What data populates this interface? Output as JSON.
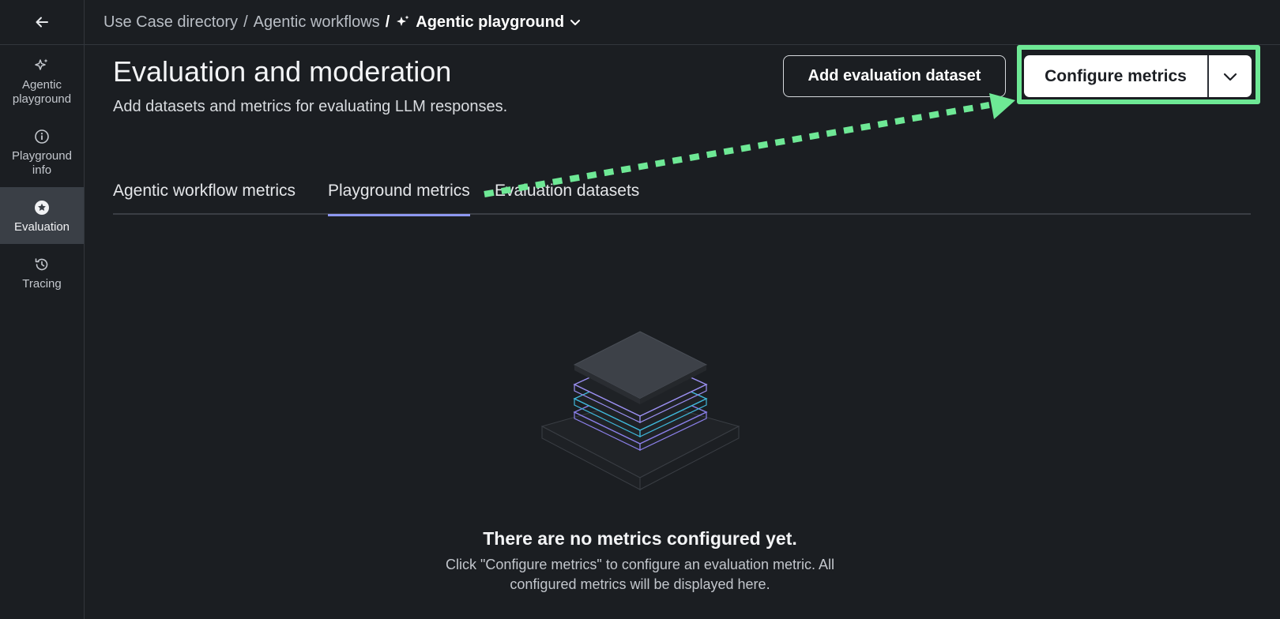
{
  "sidebar": {
    "back_icon": "arrow-left-icon",
    "items": [
      {
        "label": "Agentic playground",
        "icon": "sparkles-icon",
        "active": false
      },
      {
        "label": "Playground info",
        "icon": "info-icon",
        "active": false
      },
      {
        "label": "Evaluation",
        "icon": "star-badge-icon",
        "active": true
      },
      {
        "label": "Tracing",
        "icon": "history-icon",
        "active": false
      }
    ]
  },
  "breadcrumb": {
    "items": [
      "Use Case directory",
      "Agentic workflows"
    ],
    "separator": "/",
    "current": "Agentic playground",
    "current_icon": "sparkles-icon"
  },
  "header": {
    "title": "Evaluation and moderation",
    "subtitle": "Add datasets and metrics for evaluating LLM responses."
  },
  "actions": {
    "add_dataset_label": "Add evaluation dataset",
    "configure_metrics_label": "Configure metrics"
  },
  "tabs": [
    {
      "label": "Agentic workflow metrics",
      "active": false
    },
    {
      "label": "Playground metrics",
      "active": true
    },
    {
      "label": "Evaluation datasets",
      "active": false
    }
  ],
  "empty_state": {
    "title": "There are no metrics configured yet.",
    "description": "Click \"Configure metrics\" to configure an evaluation metric. All configured metrics will be displayed here."
  },
  "colors": {
    "background": "#1b1e22",
    "annotation": "#6ee895",
    "tab_active": "#8d97f0"
  }
}
